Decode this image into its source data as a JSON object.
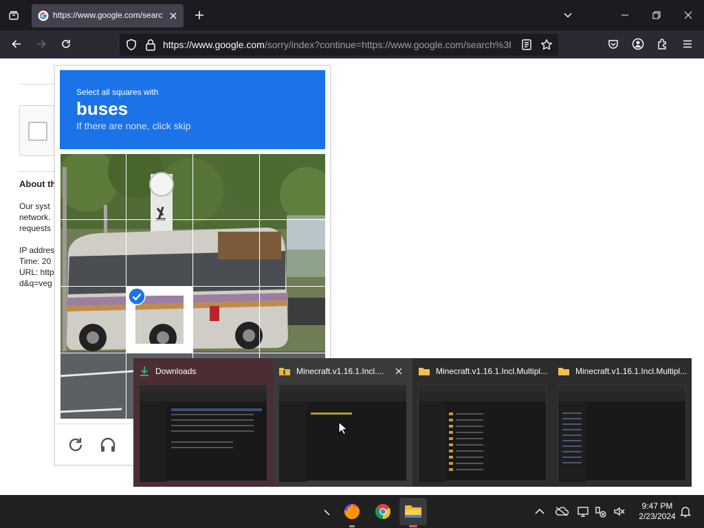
{
  "browser": {
    "tab": {
      "title": "https://www.google.com/search?",
      "favicon": "google-g-icon"
    },
    "url": {
      "domain": "https://www.google.com",
      "path": "/sorry/index?continue=https://www.google.com/search%3F"
    },
    "colors": {
      "tabstrip": "#1c1b22",
      "toolbar": "#2b2a33",
      "active_tab": "#42414d"
    }
  },
  "page": {
    "heading": "About th",
    "paragraph_lines": [
      "Our syst",
      "network.",
      "requests"
    ],
    "meta_lines": [
      "IP addres",
      "Time: 20",
      "URL: http",
      "d&q=veg"
    ]
  },
  "captcha": {
    "instruction": "Select all squares with",
    "target": "buses",
    "hint": "If there are none, click skip",
    "header_color": "#1a73e8",
    "selected_cells": [
      "row3-col2"
    ],
    "controls": [
      "reload-icon",
      "headphones-icon"
    ]
  },
  "taskbar_preview": {
    "windows": [
      {
        "title": "Downloads",
        "icon": "download-icon",
        "active": true
      },
      {
        "title": "Minecraft.v1.16.1.Incl....",
        "icon": "folder-zip-icon",
        "hovered": true
      },
      {
        "title": "Minecraft.v1.16.1.Incl.Multipl...",
        "icon": "folder-icon"
      },
      {
        "title": "Minecraft.v1.16.1.Incl.Multipl...",
        "icon": "folder-icon"
      }
    ]
  },
  "taskbar": {
    "apps": [
      "firefox-icon",
      "chrome-icon",
      "file-explorer-icon"
    ],
    "clock": {
      "time": "9:47 PM",
      "date": "2/23/2024"
    }
  }
}
